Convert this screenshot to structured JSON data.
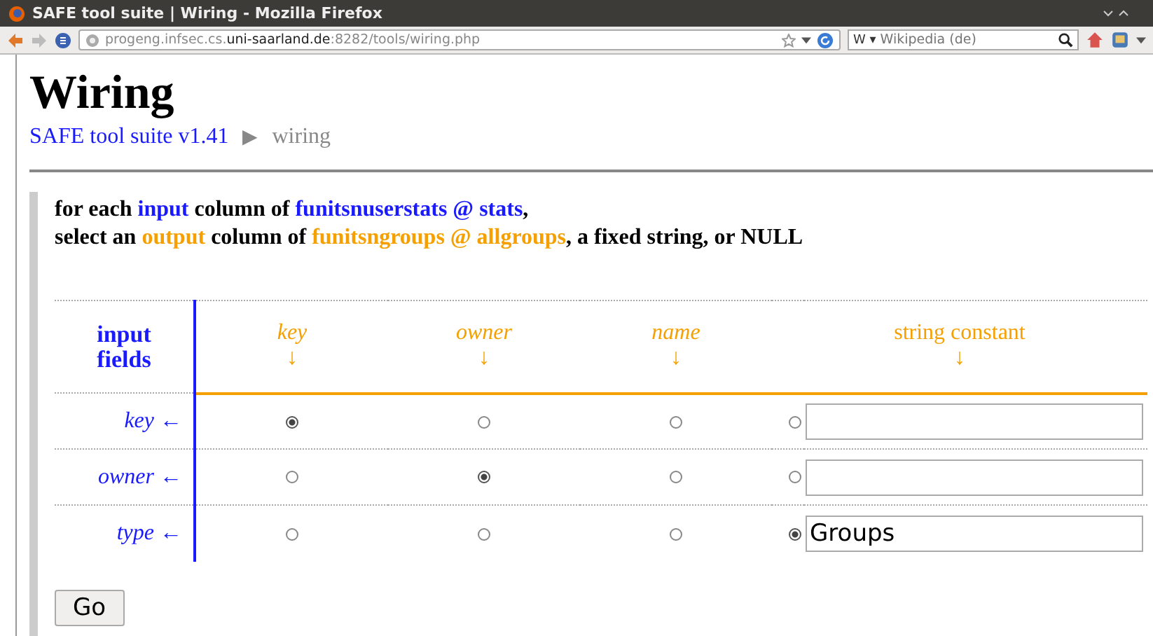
{
  "window": {
    "title": "SAFE tool suite | Wiring - Mozilla Firefox"
  },
  "toolbar": {
    "url_parts": [
      {
        "text": "progeng.infsec.cs.",
        "strong": false
      },
      {
        "text": "uni-saarland.de",
        "strong": true
      },
      {
        "text": ":8282/tools/wiring.php",
        "strong": false
      }
    ],
    "search_engine": "W ▾",
    "search_placeholder": "Wikipedia (de)"
  },
  "page": {
    "title": "Wiring",
    "breadcrumb": {
      "link": "SAFE tool suite v1.41",
      "separator": "▶",
      "current": "wiring"
    }
  },
  "instructions": [
    [
      {
        "text": "for each ",
        "kind": "plain"
      },
      {
        "text": "input",
        "kind": "input"
      },
      {
        "text": " column of ",
        "kind": "plain"
      },
      {
        "text": "funitsnuserstats @ stats",
        "kind": "input"
      },
      {
        "text": ",",
        "kind": "plain"
      }
    ],
    [
      {
        "text": "select an ",
        "kind": "plain"
      },
      {
        "text": "output",
        "kind": "output"
      },
      {
        "text": " column of ",
        "kind": "plain"
      },
      {
        "text": "funitsngroups @ allgroups",
        "kind": "output"
      },
      {
        "text": ", a fixed string, or NULL",
        "kind": "plain"
      }
    ]
  ],
  "table": {
    "header": "input fields",
    "columns": [
      {
        "label": "key",
        "kind": "column",
        "arrow": "↓"
      },
      {
        "label": "owner",
        "kind": "column",
        "arrow": "↓"
      },
      {
        "label": "name",
        "kind": "column",
        "arrow": "↓"
      },
      {
        "label": "string constant",
        "kind": "constant",
        "arrow": "↓"
      }
    ],
    "rows": [
      {
        "label": "key",
        "arrow": "←",
        "choices": [
          {
            "selected": true
          },
          {
            "selected": false
          },
          {
            "selected": false
          },
          {
            "selected": false
          }
        ],
        "value": ""
      },
      {
        "label": "owner",
        "arrow": "←",
        "choices": [
          {
            "selected": false
          },
          {
            "selected": true
          },
          {
            "selected": false
          },
          {
            "selected": false
          }
        ],
        "value": ""
      },
      {
        "label": "type",
        "arrow": "←",
        "choices": [
          {
            "selected": false
          },
          {
            "selected": false
          },
          {
            "selected": false
          },
          {
            "selected": true
          }
        ],
        "value": "Groups"
      }
    ]
  },
  "submit": "Go"
}
